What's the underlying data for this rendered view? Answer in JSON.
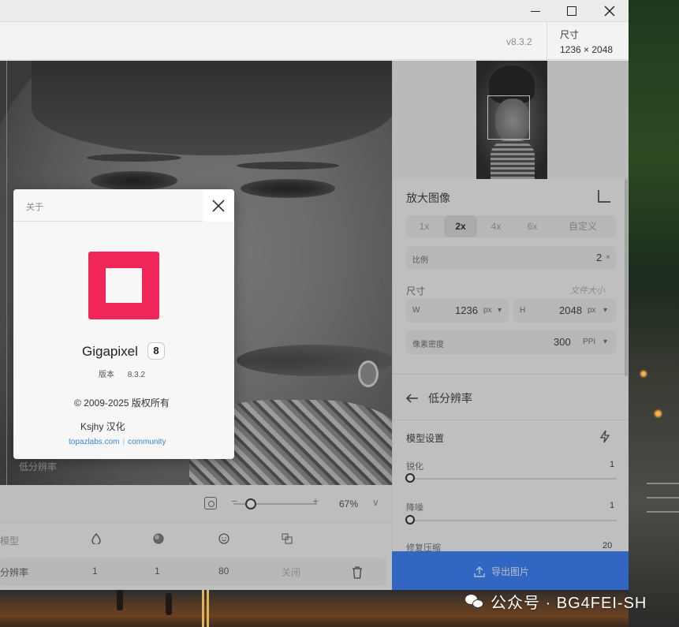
{
  "window": {
    "minimize_icon": "minimize-icon",
    "maximize_icon": "maximize-icon",
    "close_icon": "close-icon"
  },
  "topbar": {
    "version": "v8.3.2",
    "size_label": "尺寸",
    "size_value": "1236 × 2048"
  },
  "canvas": {
    "corner_label": "低分辨率"
  },
  "viewbar": {
    "zoom_percent": "67%",
    "minus": "−",
    "plus": "+",
    "chevron": "∨"
  },
  "table": {
    "headers": [
      "模型"
    ],
    "row": {
      "name": "分辨率",
      "col1": "1",
      "col2": "1",
      "col3": "80",
      "col4": "关闭"
    }
  },
  "panel": {
    "upscale_title": "放大图像",
    "scale_options": [
      "1x",
      "2x",
      "4x",
      "6x",
      "自定义"
    ],
    "selected_scale": "2x",
    "ratio_label": "比例",
    "ratio_value": "2",
    "ratio_unit": "×",
    "dimension_label": "尺寸",
    "file_size_label": "文件大小",
    "width_label": "W",
    "width_value": "1236",
    "width_unit": "px",
    "height_label": "H",
    "height_value": "2048",
    "height_unit": "px",
    "density_label": "像素密度",
    "density_value": "300",
    "density_unit": "PPI",
    "model_back_label": "低分辨率",
    "model_settings_label": "模型设置",
    "sharpen_label": "锐化",
    "sharpen_value": "1",
    "denoise_label": "降噪",
    "denoise_value": "1",
    "compress_label": "修复压缩",
    "compress_value": "20",
    "export_label": "导出图片"
  },
  "about_dialog": {
    "title": "关于",
    "app_name": "Gigapixel",
    "major_version": "8",
    "version_label": "版本",
    "version_value": "8.3.2",
    "copyright": "© 2009-2025 版权所有",
    "localized_by": "Ksjhy 汉化",
    "link_site": "topazlabs.com",
    "link_community": "community",
    "brand_color": "#f0255a"
  },
  "watermark": {
    "text": "公众号 · BG4FEI-SH"
  }
}
